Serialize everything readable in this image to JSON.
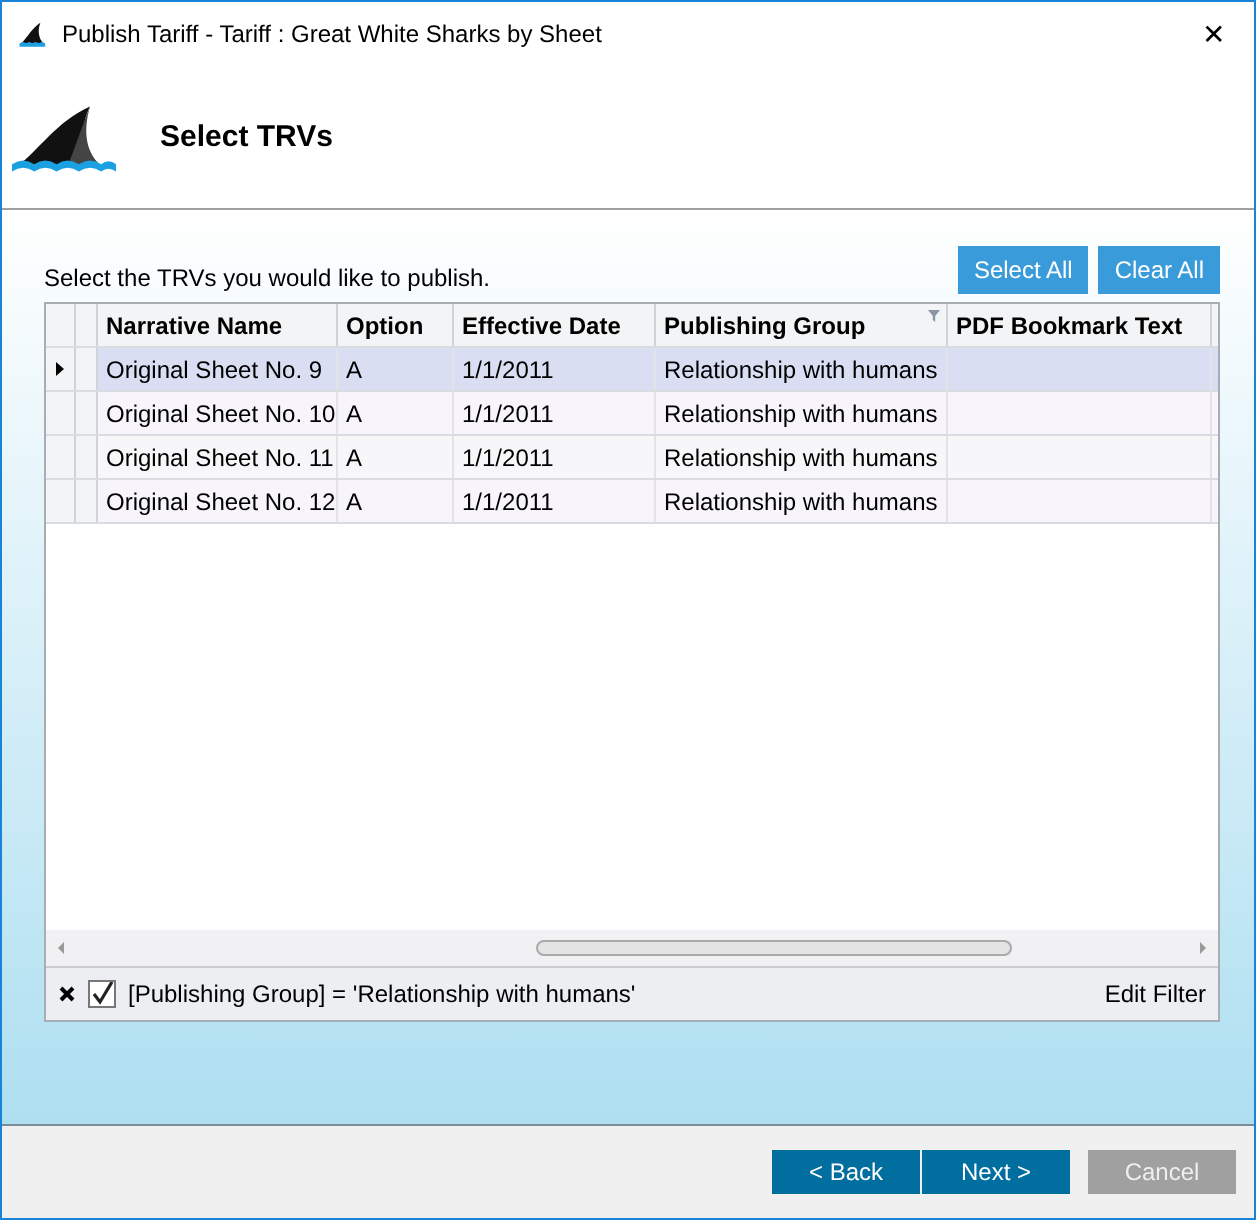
{
  "window": {
    "title": "Publish Tariff - Tariff : Great White Sharks by Sheet",
    "close": "✕"
  },
  "header": {
    "title": "Select TRVs"
  },
  "instructions": "Select the TRVs you would like to publish.",
  "actions": [
    {
      "label": "Select All"
    },
    {
      "label": "Clear All"
    }
  ],
  "table": {
    "columns": [
      {
        "label": "Narrative Name",
        "filtered": false
      },
      {
        "label": "Option",
        "filtered": false
      },
      {
        "label": "Effective Date",
        "filtered": false
      },
      {
        "label": "Publishing Group",
        "filtered": true
      },
      {
        "label": "PDF Bookmark Text",
        "filtered": false
      }
    ],
    "rows": [
      {
        "selected": true,
        "cells": [
          "Original Sheet No. 9",
          "A",
          "1/1/2011",
          "Relationship with humans",
          ""
        ]
      },
      {
        "selected": false,
        "cells": [
          "Original Sheet No. 10",
          "A",
          "1/1/2011",
          "Relationship with humans",
          ""
        ]
      },
      {
        "selected": false,
        "cells": [
          "Original Sheet No. 11",
          "A",
          "1/1/2011",
          "Relationship with humans",
          ""
        ]
      },
      {
        "selected": false,
        "cells": [
          "Original Sheet No. 12",
          "A",
          "1/1/2011",
          "Relationship with humans",
          ""
        ]
      }
    ]
  },
  "filter": {
    "checked": true,
    "text": "[Publishing Group] = 'Relationship with humans'",
    "edit": "Edit Filter"
  },
  "buttons": [
    {
      "label": "< Back",
      "disabled": false
    },
    {
      "label": "Next >",
      "disabled": false
    },
    {
      "label": "Cancel",
      "disabled": true
    }
  ]
}
